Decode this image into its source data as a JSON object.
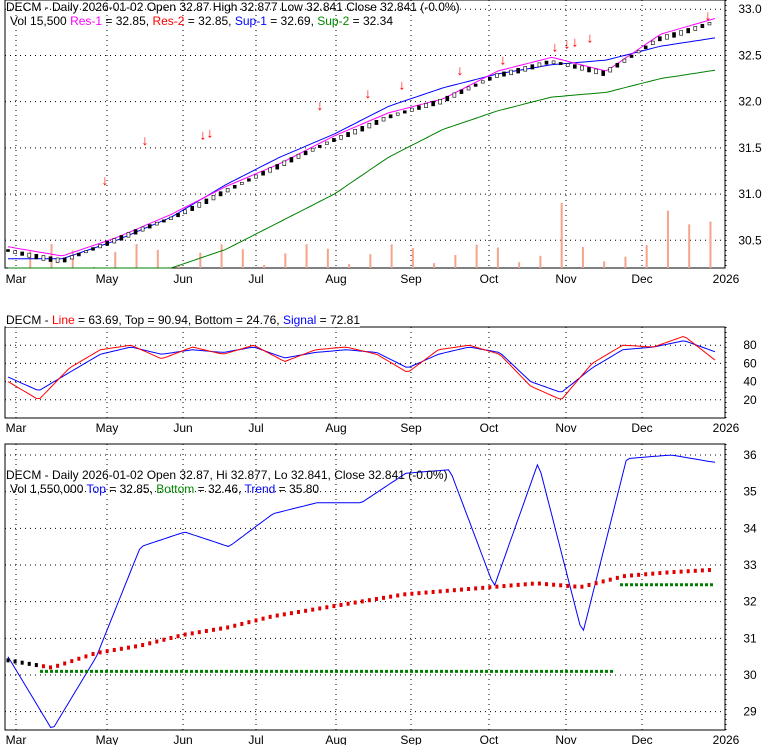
{
  "colors": {
    "res1": "#ff00ff",
    "res2": "#ff0000",
    "sup1": "#0000ff",
    "sup2": "#008000",
    "line": "#ff0000",
    "signal": "#0000ff",
    "top": "#0000ff",
    "bottom": "#008000",
    "trend": "#0000ff"
  },
  "panel1": {
    "title": "DECM - Daily 2026-01-02 Open 32.87  High 32.877  Low 32.841  Close 32.841 (-0.0%)",
    "vol": "Vol 15,500",
    "res1": "Res-1",
    "res1_val": " = 32.85, ",
    "res2": "Res-2",
    "res2_val": " = 32.85, ",
    "sup1": "Sup-1",
    "sup1_val": " = 32.69, ",
    "sup2": "Sup-2",
    "sup2_val": " = 32.34"
  },
  "panel2": {
    "prefix": "DECM - ",
    "line": "Line",
    "line_val": " = 63.69, Top = 90.94, Bottom = 24.76, ",
    "signal": "Signal",
    "signal_val": " = 72.81"
  },
  "panel3": {
    "title": "DECM - Daily 2026-01-02 Open 32.87, Hi 32.877, Lo 32.841, Close 32.841 (-0.0%)",
    "vol": "Vol 1,550,000 ",
    "top": "Top",
    "top_val": " = 32.85, ",
    "bottom": "Bottom",
    "bottom_val": " = 32.46, ",
    "trend": "Trend",
    "trend_val": " = 35.80"
  },
  "chart_data": [
    {
      "type": "line",
      "title": "DECM Daily price with support/resistance",
      "x_labels": [
        "Mar",
        "May",
        "Jun",
        "Jul",
        "Aug",
        "Sep",
        "Oct",
        "Nov",
        "Dec",
        "2026"
      ],
      "y_ticks": [
        "33.0",
        "32.5",
        "32.0",
        "31.5",
        "31.0",
        "30.5"
      ],
      "ylim": [
        30.2,
        33.1
      ],
      "close": [
        30.4,
        30.3,
        30.5,
        30.75,
        31.05,
        31.3,
        31.6,
        31.85,
        32.0,
        32.3,
        32.45,
        32.3,
        32.7,
        32.87
      ],
      "sup1": [
        30.3,
        30.3,
        30.5,
        30.75,
        31.1,
        31.4,
        31.65,
        31.95,
        32.15,
        32.3,
        32.4,
        32.45,
        32.6,
        32.69
      ],
      "sup2": [
        30.2,
        30.2,
        30.2,
        30.2,
        30.4,
        30.7,
        31.0,
        31.4,
        31.7,
        31.9,
        32.05,
        32.1,
        32.25,
        32.34
      ]
    },
    {
      "type": "line",
      "title": "Stochastic",
      "y_ticks": [
        "80",
        "60",
        "40",
        "20"
      ],
      "ylim": [
        0,
        100
      ],
      "line": [
        40,
        20,
        55,
        75,
        80,
        65,
        78,
        70,
        80,
        62,
        75,
        78,
        70,
        50,
        75,
        80,
        70,
        35,
        20,
        60,
        80,
        78,
        90,
        63.69
      ],
      "signal": [
        45,
        30,
        50,
        70,
        78,
        70,
        75,
        72,
        78,
        66,
        72,
        75,
        72,
        55,
        70,
        78,
        72,
        40,
        28,
        55,
        75,
        78,
        85,
        72.81
      ]
    },
    {
      "type": "line",
      "title": "Trend",
      "y_ticks": [
        "36",
        "35",
        "34",
        "33",
        "32",
        "31",
        "30",
        "29"
      ],
      "ylim": [
        28.5,
        36.3
      ],
      "trend": [
        30.5,
        28.5,
        30.5,
        33.5,
        33.9,
        33.5,
        34.4,
        34.7,
        34.7,
        35.5,
        35.6,
        32.4,
        35.8,
        31.1,
        35.9,
        36,
        35.8
      ],
      "price": [
        30.4,
        30.2,
        30.6,
        30.8,
        31.1,
        31.3,
        31.6,
        31.8,
        32.0,
        32.2,
        32.3,
        32.4,
        32.5,
        32.4,
        32.7,
        32.8,
        32.87
      ]
    }
  ]
}
